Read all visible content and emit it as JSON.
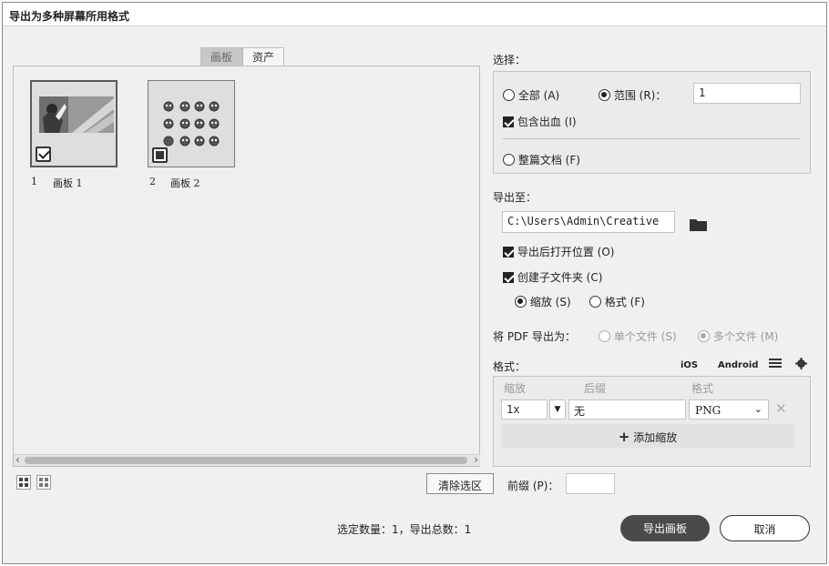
{
  "window": {
    "title": "导出为多种屏幕所用格式"
  },
  "left": {
    "tabs": [
      "画板",
      "资产"
    ],
    "artboards": [
      {
        "number": "1",
        "label": "画板 1",
        "checked": true
      },
      {
        "number": "2",
        "label": "画板 2",
        "checked": false
      }
    ],
    "clear_selection": "清除选区",
    "prefix_label": "前缀 (P)：",
    "prefix_value": "",
    "summary": "选定数量：1，导出总数：1"
  },
  "select": {
    "heading": "选择：",
    "all": "全部 (A)",
    "range": "范围 (R)：",
    "range_value": "1",
    "include_bleed": "包含出血 (I)",
    "whole_document": "整篇文档 (F)"
  },
  "export_to": {
    "heading": "导出至：",
    "path": "C:\\Users\\Admin\\Creative",
    "open_after": "导出后打开位置 (O)",
    "create_subfolders": "创建子文件夹 (C)",
    "scale": "缩放 (S)",
    "format": "格式 (F)"
  },
  "pdf": {
    "label": "将 PDF 导出为：",
    "single": "单个文件 (S)",
    "multiple": "多个文件 (M)"
  },
  "formats": {
    "heading": "格式：",
    "ios": "iOS",
    "android": "Android",
    "col_scale": "缩放",
    "col_suffix": "后缀",
    "col_format": "格式",
    "scale_value": "1x",
    "suffix_value": "无",
    "format_value": "PNG",
    "add_scale": "添加缩放"
  },
  "footer": {
    "export_button": "导出画板",
    "cancel_button": "取消"
  }
}
